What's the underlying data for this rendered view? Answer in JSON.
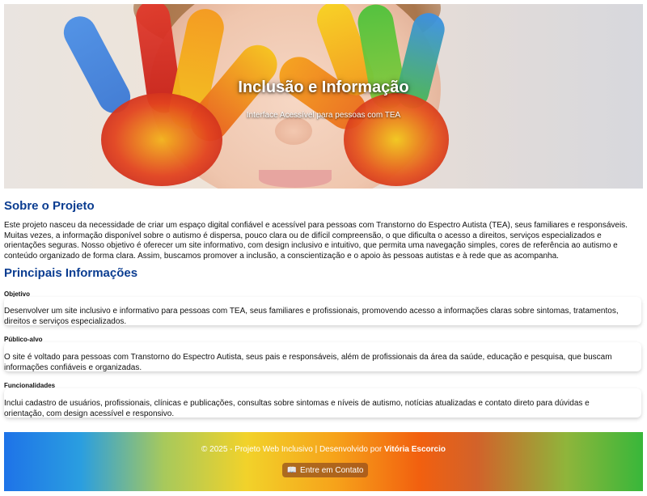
{
  "hero": {
    "title": "Inclusão e Informação",
    "subtitle": "Interface Acessível para pessoas com TEA"
  },
  "about": {
    "heading": "Sobre o Projeto",
    "text": "Este projeto nasceu da necessidade de criar um espaço digital confiável e acessível para pessoas com Transtorno do Espectro Autista (TEA), seus familiares e responsáveis. Muitas vezes, a informação disponível sobre o autismo é dispersa, pouco clara ou de difícil compreensão, o que dificulta o acesso a direitos, serviços especializados e orientações seguras. Nosso objetivo é oferecer um site informativo, com design inclusivo e intuitivo, que permita uma navegação simples, cores de referência ao autismo e conteúdo organizado de forma clara. Assim, buscamos promover a inclusão, a conscientização e o apoio às pessoas autistas e à rede que as acompanha."
  },
  "info": {
    "heading": "Principais Informações",
    "cards": [
      {
        "title": "Objetivo",
        "text": "Desenvolver um site inclusivo e informativo para pessoas com TEA, seus familiares e profissionais, promovendo acesso a informações claras sobre sintomas, tratamentos, direitos e serviços especializados."
      },
      {
        "title": "Público-alvo",
        "text": "O site é voltado para pessoas com Transtorno do Espectro Autista, seus pais e responsáveis, além de profissionais da área da saúde, educação e pesquisa, que buscam informações confiáveis e organizadas."
      },
      {
        "title": "Funcionalidades",
        "text": "Inclui cadastro de usuários, profissionais, clínicas e publicações, consultas sobre sintomas e níveis de autismo, notícias atualizadas e contato direto para dúvidas e orientação, com design acessível e responsivo."
      }
    ]
  },
  "footer": {
    "text": "© 2025 - Projeto Web Inclusivo | Desenvolvido por ",
    "author": "Vitória Escorcio",
    "contact_label": "Entre em Contato",
    "contact_icon": "book-icon"
  }
}
